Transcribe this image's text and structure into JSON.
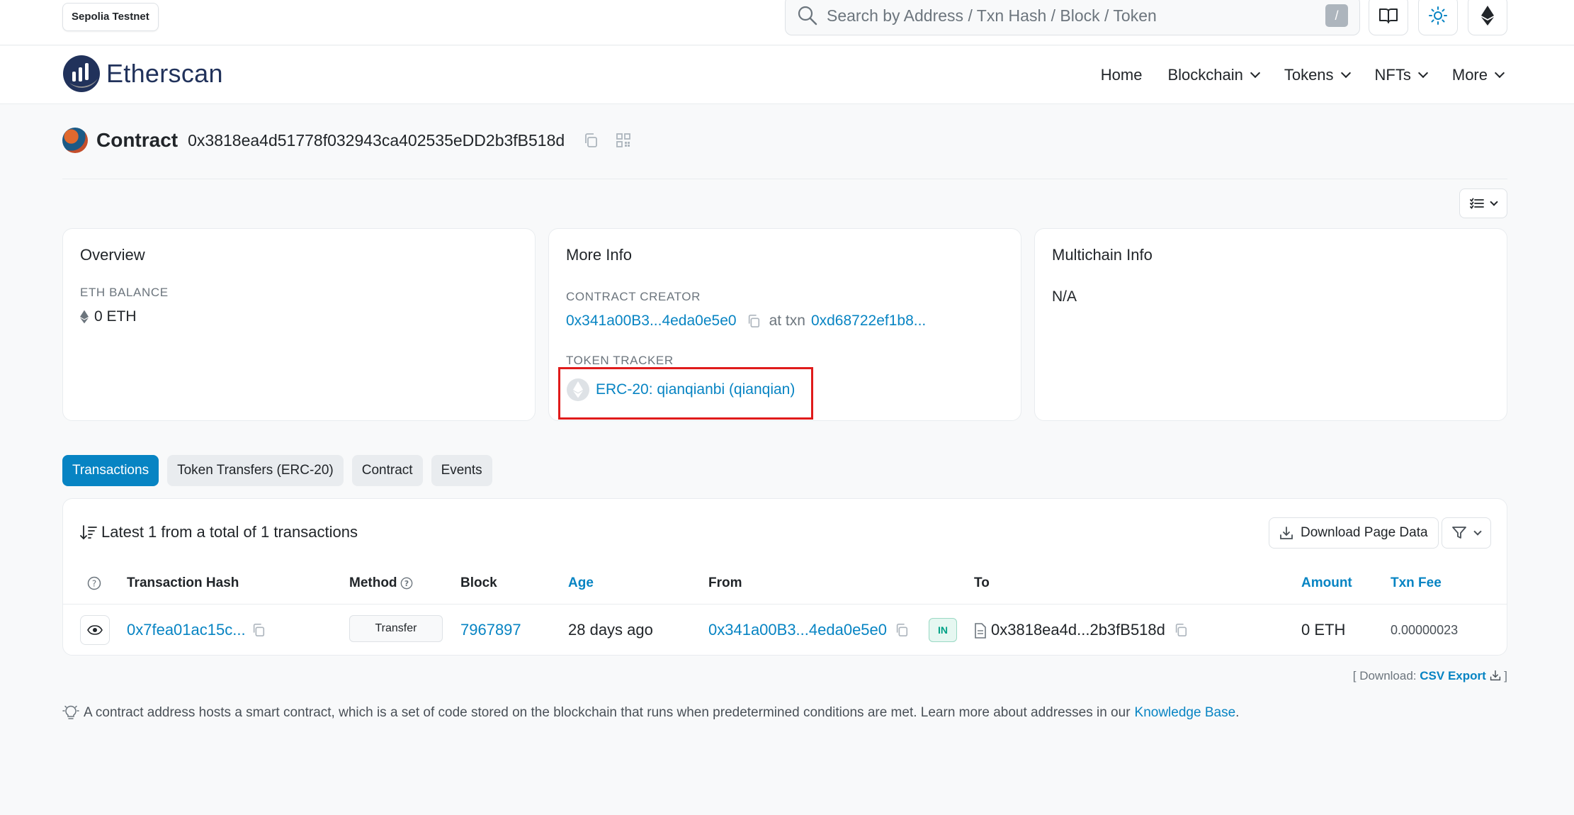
{
  "topbar": {
    "network_badge": "Sepolia Testnet",
    "search_placeholder": "Search by Address / Txn Hash / Block / Token",
    "search_shortcut": "/"
  },
  "nav": {
    "brand": "Etherscan",
    "items": [
      "Home",
      "Blockchain",
      "Tokens",
      "NFTs",
      "More"
    ]
  },
  "contract": {
    "label": "Contract",
    "address": "0x3818ea4d51778f032943ca402535eDD2b3fB518d"
  },
  "overview": {
    "title": "Overview",
    "balance_label": "ETH BALANCE",
    "balance_value": "0 ETH"
  },
  "more_info": {
    "title": "More Info",
    "creator_label": "CONTRACT CREATOR",
    "creator_address": "0x341a00B3...4eda0e5e0",
    "at_txn_text": "at txn",
    "creator_txn": "0xd68722ef1b8...",
    "token_tracker_label": "TOKEN TRACKER",
    "token_tracker_value": "ERC-20: qianqianbi (qianqian)"
  },
  "multichain": {
    "title": "Multichain Info",
    "value": "N/A"
  },
  "tabs": [
    "Transactions",
    "Token Transfers (ERC-20)",
    "Contract",
    "Events"
  ],
  "transactions": {
    "summary": "Latest 1 from a total of 1 transactions",
    "download_label": "Download Page Data",
    "headers": [
      "Transaction Hash",
      "Method",
      "Block",
      "Age",
      "From",
      "To",
      "Amount",
      "Txn Fee"
    ],
    "rows": [
      {
        "hash": "0x7fea01ac15c...",
        "method": "Transfer",
        "block": "7967897",
        "age": "28 days ago",
        "from": "0x341a00B3...4eda0e5e0",
        "direction": "IN",
        "to": "0x3818ea4d...2b3fB518d",
        "amount": "0 ETH",
        "fee": "0.00000023"
      }
    ]
  },
  "footer": {
    "download_prefix": "[ Download:",
    "csv_label": "CSV Export",
    "download_suffix": "]",
    "note_text": "A contract address hosts a smart contract, which is a set of code stored on the blockchain that runs when predetermined conditions are met. Learn more about addresses in our",
    "note_link": "Knowledge Base",
    "note_end": "."
  },
  "colors": {
    "link": "#0784c3",
    "highlight_box": "#e01b1b",
    "brand_dark": "#21325b"
  }
}
